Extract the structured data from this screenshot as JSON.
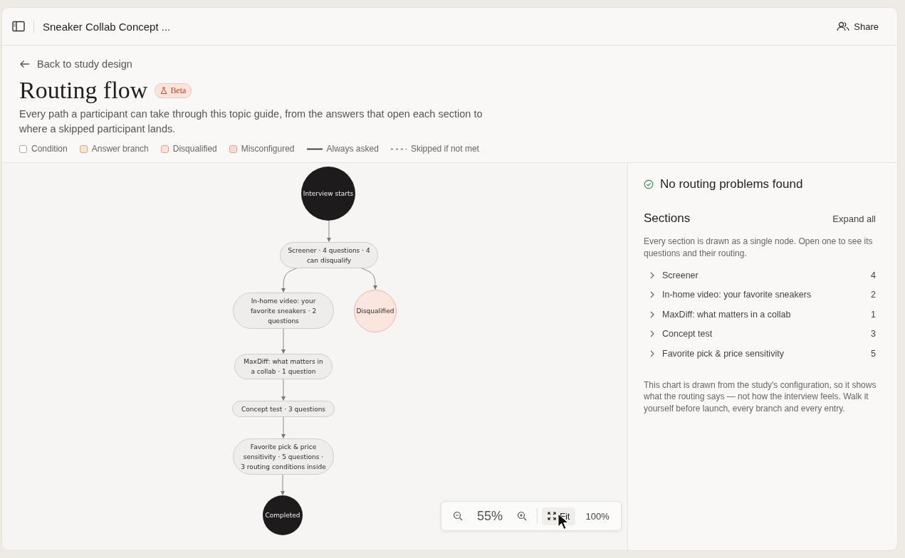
{
  "header": {
    "title": "Sneaker Collab Concept ...",
    "share": "Share"
  },
  "back_link": "Back to study design",
  "page_title": "Routing flow",
  "badge": "Beta",
  "description": "Every path a participant can take through this topic guide, from the answers that open each section to where a skipped participant lands.",
  "legend": [
    {
      "kind": "swatch",
      "label": "Condition",
      "color": "#ffffff"
    },
    {
      "kind": "swatch",
      "label": "Answer branch",
      "color": "#f7e4cf"
    },
    {
      "kind": "swatch",
      "label": "Disqualified",
      "color": "#fbe3dc"
    },
    {
      "kind": "swatch",
      "label": "Misconfigured",
      "color": "#f9dada"
    },
    {
      "kind": "solid",
      "label": "Always asked"
    },
    {
      "kind": "dashed",
      "label": "Skipped if not met"
    }
  ],
  "flow": {
    "nodes": [
      {
        "kind": "terminal",
        "label": "Interview starts"
      },
      {
        "kind": "section",
        "label": "Screener · 4 questions · 4 can disqualify"
      },
      {
        "kind": "section",
        "label": "In-home video: your favorite sneakers · 2 questions"
      },
      {
        "kind": "disqualified",
        "label": "Disqualified"
      },
      {
        "kind": "section",
        "label": "MaxDiff: what matters in a collab · 1 question"
      },
      {
        "kind": "section",
        "label": "Concept test · 3 questions"
      },
      {
        "kind": "section",
        "label": "Favorite pick & price sensitivity · 5 questions · 3 routing conditions inside"
      },
      {
        "kind": "terminal",
        "label": "Completed"
      }
    ]
  },
  "zoom_bar": {
    "level": "55%",
    "fit": "Fit",
    "actual": "100%"
  },
  "panel": {
    "status": "No routing problems found",
    "sections_title": "Sections",
    "expand_all": "Expand all",
    "intro": "Every section is drawn as a single node. Open one to see its questions and their routing.",
    "sections": [
      {
        "name": "Screener",
        "count": "4",
        "expanded": false
      },
      {
        "name": "In-home video: your favorite sneakers",
        "count": "2",
        "expanded": false
      },
      {
        "name": "MaxDiff: what matters in a collab",
        "count": "1",
        "expanded": false
      },
      {
        "name": "Concept test",
        "count": "3",
        "expanded": false
      },
      {
        "name": "Favorite pick & price sensitivity",
        "count": "5",
        "expanded": false
      }
    ],
    "note": "This chart is drawn from the study's configuration, so it shows what the routing says — not how the interview feels. Walk it yourself before launch, every branch and every entry."
  }
}
